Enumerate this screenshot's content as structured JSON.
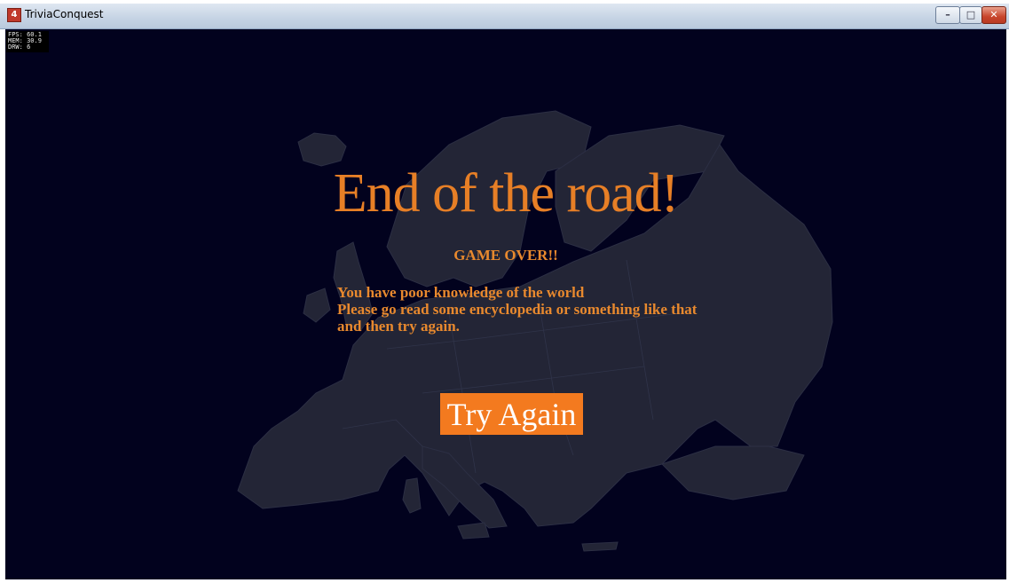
{
  "window": {
    "title": "TriviaConquest",
    "icon": "app-logo-icon",
    "controls": {
      "minimize": "–",
      "maximize": "□",
      "close": "✕"
    }
  },
  "debug": {
    "fps": "FPS: 60.1",
    "mem": "MEM: 30.9",
    "drw": "DRW: 6"
  },
  "screen": {
    "title": "End of the road!",
    "subtitle": "GAME OVER!!",
    "message_lines": [
      "You have poor knowledge of the world",
      "Please go read some encyclopedia or something like that",
      "and then try again."
    ],
    "button_label": "Try Again"
  },
  "colors": {
    "background": "#02021e",
    "accent": "#f37a1f",
    "text": "#e8892e",
    "map": "#232536"
  }
}
